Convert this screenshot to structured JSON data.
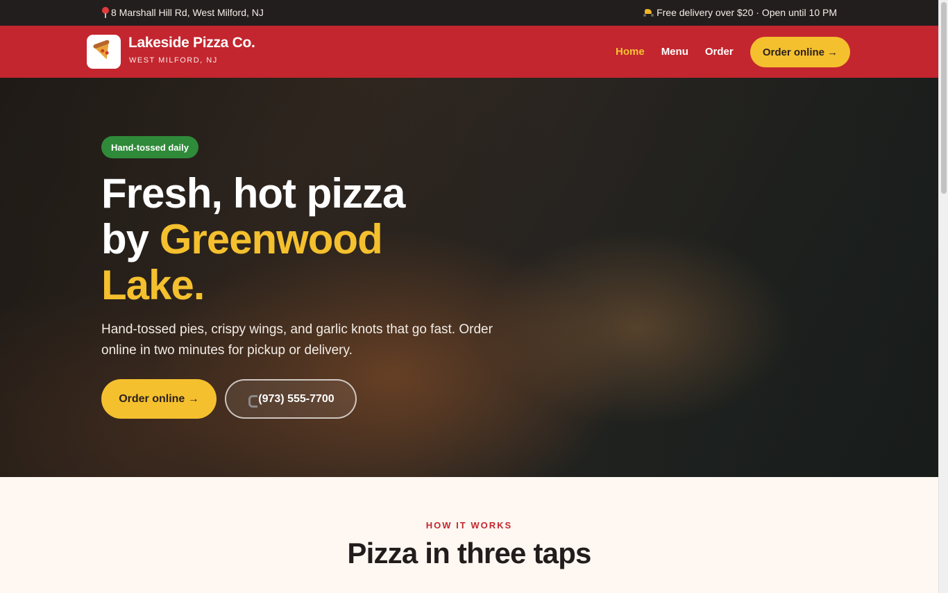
{
  "topbar": {
    "address": "8 Marshall Hill Rd, West Milford, NJ",
    "address_icon": "map-pin-icon",
    "delivery_note": "Free delivery over $20 · Open until 10 PM",
    "delivery_icon": "scooter-icon"
  },
  "brand": {
    "name": "Lakeside Pizza Co.",
    "location": "WEST MILFORD, NJ",
    "logo_icon": "pizza-slice-icon"
  },
  "nav": {
    "items": [
      {
        "label": "Home",
        "active": true
      },
      {
        "label": "Menu",
        "active": false
      },
      {
        "label": "Order",
        "active": false
      }
    ],
    "cta_label": "Order online →"
  },
  "hero": {
    "badge": "Hand-tossed daily",
    "headline_part1": "Fresh, hot pizza",
    "headline_part2": "by ",
    "headline_accent": "Greenwood Lake.",
    "lede": "Hand-tossed pies, crispy wings, and garlic knots that go fast. Order online in two minutes for pickup or delivery.",
    "primary_cta": "Order online →",
    "phone": "(973) 555-7700",
    "phone_icon": "phone-icon"
  },
  "how_it_works": {
    "eyebrow": "HOW IT WORKS",
    "title": "Pizza in three taps"
  },
  "colors": {
    "brand_red": "#c3262e",
    "accent_yellow": "#f4c02e",
    "badge_green": "#2f8a3a",
    "topbar_dark": "#231e1e",
    "cream": "#fff8f2"
  }
}
